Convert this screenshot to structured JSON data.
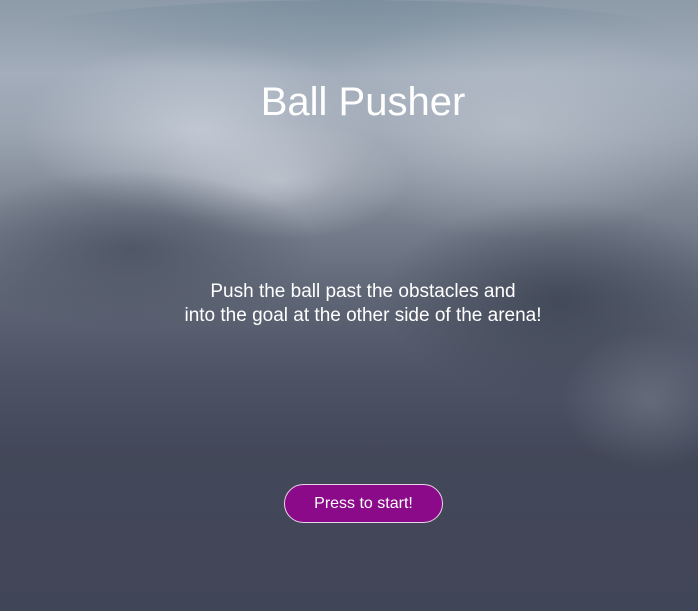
{
  "game": {
    "title": "Ball Pusher",
    "description_line1": "Push the ball past the obstacles and",
    "description_line2": "into the goal at the other side of the arena!",
    "start_button_label": "Press to start!"
  },
  "colors": {
    "button_background": "#8a0a8a",
    "button_border": "#e6d6e6",
    "text": "#ffffff",
    "sky_bottom": "#414558"
  }
}
